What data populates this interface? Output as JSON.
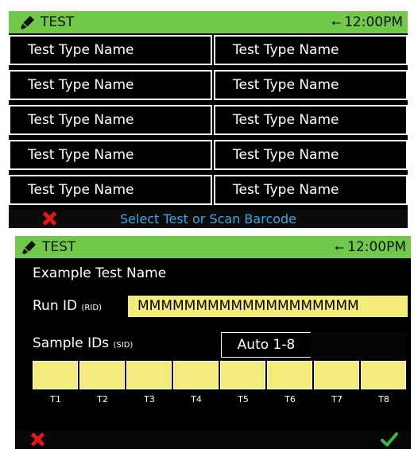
{
  "screen1": {
    "status_title": "TEST",
    "status_time": "12:00PM",
    "tests": [
      "Test Type Name",
      "Test Type Name",
      "Test Type Name",
      "Test Type Name",
      "Test Type Name",
      "Test Type Name",
      "Test Type Name",
      "Test Type Name",
      "Test Type Name",
      "Test Type Name"
    ],
    "hint": "Select Test or Scan Barcode"
  },
  "screen2": {
    "status_title": "TEST",
    "status_time": "12:00PM",
    "test_name": "Example Test Name",
    "run_id_label": "Run ID",
    "run_id_abbr": "(RID)",
    "run_id_value": "MMMMMMMMMMMMMMMMMMM",
    "sample_ids_label": "Sample IDs",
    "sample_ids_abbr": "(SID)",
    "sample_mode": "Auto 1-8",
    "tubes": [
      "T1",
      "T2",
      "T3",
      "T4",
      "T5",
      "T6",
      "T7",
      "T8"
    ]
  },
  "colors": {
    "status_bar": "#72c84a",
    "field": "#f4ec7a",
    "hint": "#39a9e6",
    "cancel": "#e01818",
    "confirm": "#3cb83a"
  },
  "icons": [
    "pen-icon",
    "usb-icon",
    "close-icon",
    "check-icon"
  ]
}
